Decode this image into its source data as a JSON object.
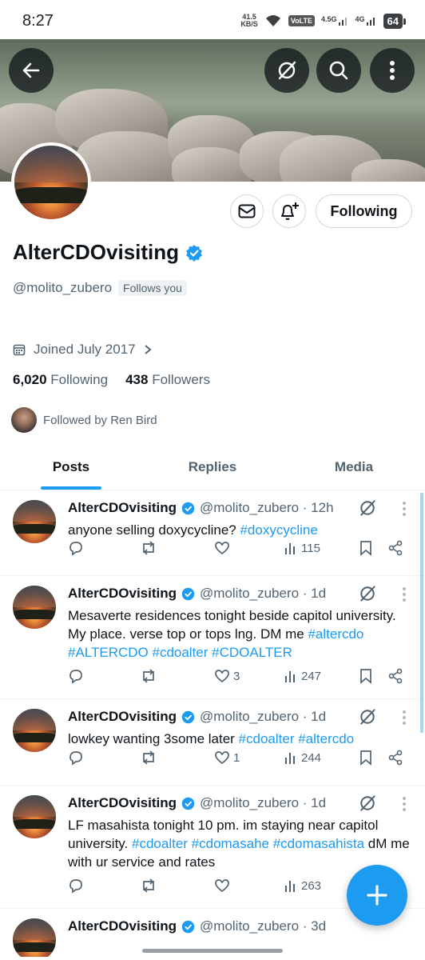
{
  "status_bar": {
    "time": "8:27",
    "speed_value": "41.5",
    "speed_unit": "KB/S",
    "volte": "VoLTE",
    "net1": "4.5G",
    "net2": "4G",
    "battery": "64"
  },
  "header": {
    "back_icon": "arrow-left-icon",
    "grok_icon": "grok-icon",
    "search_icon": "search-icon",
    "more_icon": "more-vertical-icon"
  },
  "profile": {
    "display_name": "AlterCDOvisiting",
    "handle": "@molito_zubero",
    "follows_you": "Follows you",
    "joined": "Joined July 2017",
    "following_count": "6,020",
    "following_label": "Following",
    "followers_count": "438",
    "followers_label": "Followers",
    "followed_by": "Followed by Ren Bird",
    "following_button": "Following"
  },
  "tabs": [
    {
      "label": "Posts",
      "active": true
    },
    {
      "label": "Replies",
      "active": false
    },
    {
      "label": "Media",
      "active": false
    }
  ],
  "posts": [
    {
      "name": "AlterCDOvisiting",
      "meta": "@molito_zubero · 12h",
      "text": "anyone selling doxycycline? ",
      "hashtags": "#doxycycline",
      "likes": "",
      "views": "115"
    },
    {
      "name": "AlterCDOvisiting",
      "meta": "@molito_zubero · 1d",
      "text": "Mesaverte residences tonight beside capitol university. My place. verse top or tops lng. DM me ",
      "hashtags": "#altercdo #ALTERCDO #cdoalter #CDOALTER",
      "likes": "3",
      "views": "247"
    },
    {
      "name": "AlterCDOvisiting",
      "meta": "@molito_zubero · 1d",
      "text": "lowkey wanting 3some later ",
      "hashtags": "#cdoalter #altercdo",
      "likes": "1",
      "views": "244"
    },
    {
      "name": "AlterCDOvisiting",
      "meta": "@molito_zubero · 1d",
      "text_before": "LF masahista tonight 10 pm. im staying near capitol university. ",
      "hashtags": "#cdoalter #cdomasahe #cdomasahista",
      "text_after": " dM me with ur service and rates",
      "likes": "",
      "views": "263"
    },
    {
      "name": "AlterCDOvisiting",
      "meta": "@molito_zubero · 3d"
    }
  ],
  "fab_icon": "plus-icon"
}
